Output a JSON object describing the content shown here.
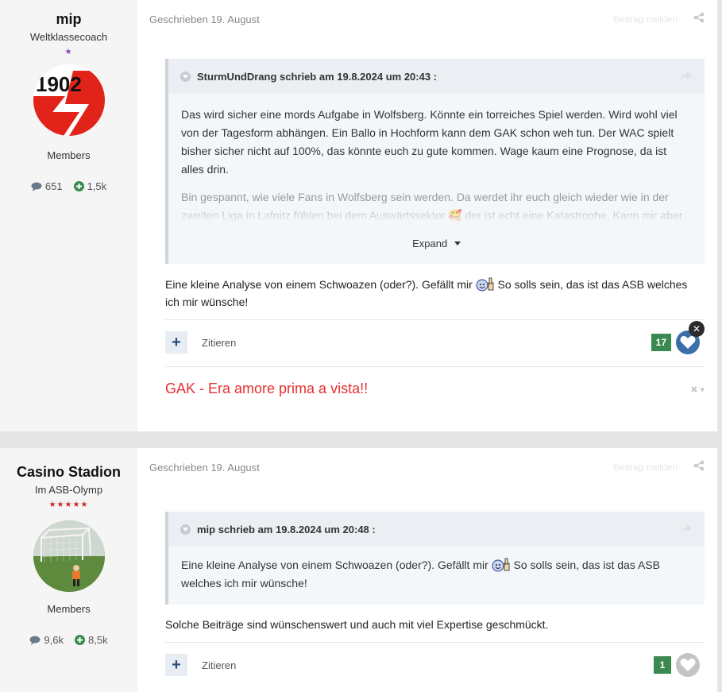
{
  "posts": [
    {
      "author": {
        "name": "mip",
        "title": "Weltklassecoach",
        "stars": "★",
        "avatar": "gak-1902-logo",
        "avatar_text": "1902",
        "group": "Members",
        "comments": "651",
        "reputation": "1,5k"
      },
      "meta": "Geschrieben 19. August",
      "report_label": "Beitrag melden",
      "quote": {
        "header": "SturmUndDrang schrieb am 19.8.2024 um 20:43 :",
        "paragraphs": [
          "Das wird sicher eine mords Aufgabe in Wolfsberg. Könnte ein torreiches Spiel werden. Wird wohl viel von der Tagesform abhängen. Ein Ballo in Hochform kann dem GAK schon weh tun. Der WAC spielt bisher sicher nicht auf 100%, das könnte euch zu gute kommen. Wage kaum eine Prognose, da ist alles drin.",
          "Bin gespannt, wie viele Fans in Wolfsberg sein werden. Da werdet ihr euch gleich wieder wie in der zweiten Liga in Lafnitz fühlen bei dem Auswärtssektor 🥰 der ist echt eine Katastrophe. Kann mir aber"
        ],
        "expand_label": "Expand"
      },
      "text_before_emoji": "Eine kleine Analyse von einem Schwoazen (oder?). Gefällt mir",
      "text_after_emoji": " So solls sein, das ist das ASB welches ich mir wünsche!",
      "quote_label": "Zitieren",
      "reaction_count": "17",
      "signature": "GAK - Era amore prima a vista!!"
    },
    {
      "author": {
        "name": "Casino Stadion",
        "title": "Im ASB-Olymp",
        "stars": "★★★★★",
        "avatar": "stadium-photo",
        "group": "Members",
        "comments": "9,6k",
        "reputation": "8,5k"
      },
      "meta": "Geschrieben 19. August",
      "report_label": "Beitrag melden",
      "quote": {
        "header": "mip schrieb am 19.8.2024 um 20:48 :",
        "text_before_emoji": "Eine kleine Analyse von einem Schwoazen (oder?). Gefällt mir",
        "text_after_emoji": " So solls sein, das ist das ASB welches ich mir wünsche!"
      },
      "text": "Solche Beiträge sind wünschenswert und auch mit viel Expertise geschmückt.",
      "quote_label": "Zitieren",
      "reaction_count": "1"
    }
  ],
  "colors": {
    "reaction_green": "#3a8a4f",
    "heart_blue": "#3b6fa8",
    "signature_red": "#e53030",
    "rank_purple": "#8b3fc2",
    "rank_red": "#cc2a2a"
  }
}
